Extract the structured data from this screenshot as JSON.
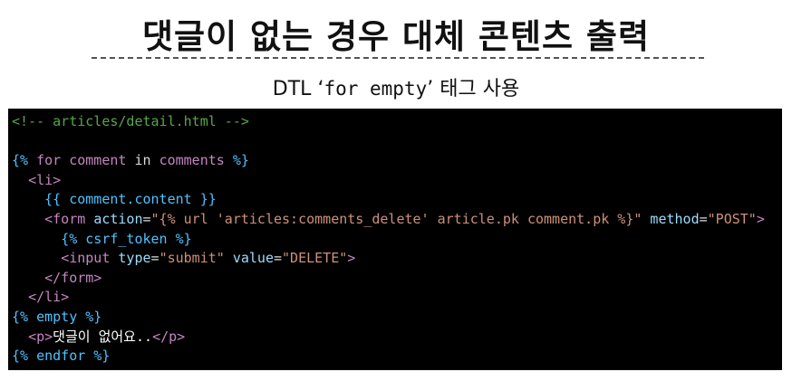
{
  "title": "댓글이 없는 경우 대체 콘텐츠 출력",
  "subtitle": {
    "prefix": "DTL ",
    "open_quote": "‘",
    "code": "for empty",
    "close_quote": "’",
    "suffix": " 태그 사용"
  },
  "code": {
    "l1": "<!-- articles/detail.html -->",
    "l3_open": "{%",
    "l3_for": "for",
    "l3_comment": "comment",
    "l3_in": "in",
    "l3_comments": "comments",
    "l3_close": "%}",
    "l4_open": "<",
    "l4_tag": "li",
    "l4_close": ">",
    "l5": "{{ comment.content }}",
    "l6_open": "<",
    "l6_tag": "form",
    "l6_attr1": "action",
    "l6_eq1": "=",
    "l6_val1": "\"{% url 'articles:comments_delete' article.pk comment.pk %}\"",
    "l6_attr2": "method",
    "l6_eq2": "=",
    "l6_val2": "\"POST\"",
    "l6_close": ">",
    "l7": "{% csrf_token %}",
    "l8_open": "<",
    "l8_tag": "input",
    "l8_attr1": "type",
    "l8_eq1": "=",
    "l8_val1": "\"submit\"",
    "l8_attr2": "value",
    "l8_eq2": "=",
    "l8_val2": "\"DELETE\"",
    "l8_close": ">",
    "l9": "</form>",
    "l10": "</li>",
    "l11": "{% empty %}",
    "l12_open": "<p>",
    "l12_text": "댓글이 없어요..",
    "l12_close": "</p>",
    "l13": "{% endfor %}"
  }
}
